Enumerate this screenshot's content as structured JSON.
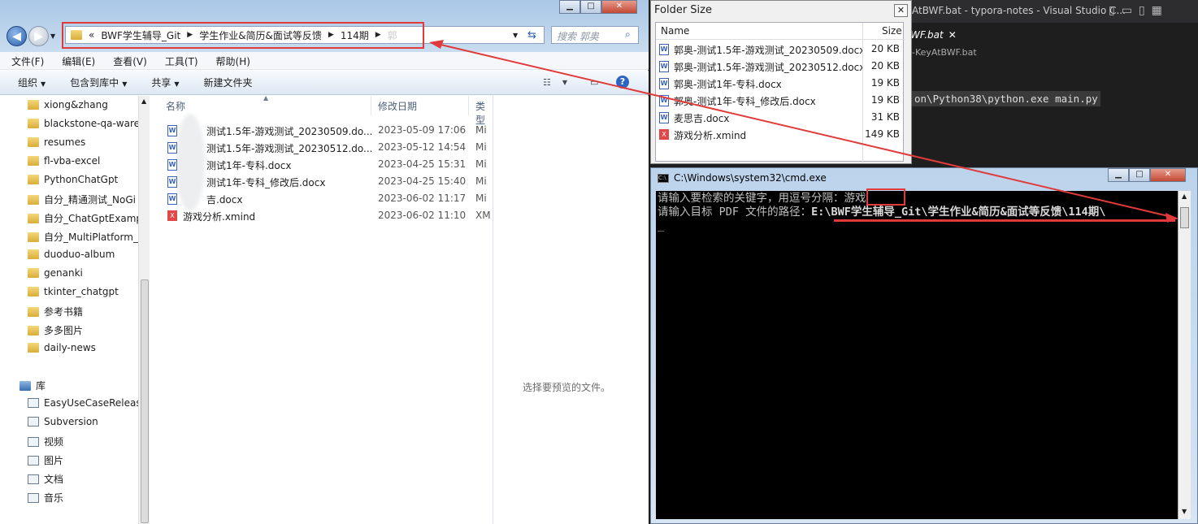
{
  "vscode": {
    "title": "AtBWF.bat - typora-notes - Visual Studio C...",
    "tab_label": "WF.bat",
    "breadcrumb": "-KeyAtBWF.bat",
    "code_line": "on\\Python38\\python.exe main.py"
  },
  "explorer": {
    "address": {
      "overflow": "«",
      "segments": [
        "BWF学生辅导_Git",
        "学生作业&简历&面试等反馈",
        "114期",
        "郭"
      ]
    },
    "search_placeholder": "搜索 郭奥",
    "menu": [
      "文件(F)",
      "编辑(E)",
      "查看(V)",
      "工具(T)",
      "帮助(H)"
    ],
    "toolbar": [
      "组织",
      "包含到库中",
      "共享",
      "新建文件夹"
    ],
    "nav_folders": [
      "xiong&zhang",
      "blackstone-qa-ware",
      "resumes",
      "fl-vba-excel",
      "PythonChatGpt",
      "自分_精通测试_NoGi",
      "自分_ChatGptExamp",
      "自分_MultiPlatform_",
      "duoduo-album",
      "genanki",
      "tkinter_chatgpt",
      "参考书籍",
      "多多图片",
      "daily-news"
    ],
    "library_label": "库",
    "libraries": [
      "EasyUseCaseRelease",
      "Subversion",
      "视频",
      "图片",
      "文档",
      "音乐"
    ],
    "columns": {
      "name": "名称",
      "date": "修改日期",
      "type": "类型"
    },
    "files": [
      {
        "name": "测试1.5年-游戏测试_20230509.do...",
        "date": "2023-05-09 17:06",
        "type": "Mi",
        "kind": "word"
      },
      {
        "name": "测试1.5年-游戏测试_20230512.do...",
        "date": "2023-05-12 14:54",
        "type": "Mi",
        "kind": "word"
      },
      {
        "name": "测试1年-专科.docx",
        "date": "2023-04-25 15:31",
        "type": "Mi",
        "kind": "word"
      },
      {
        "name": "测试1年-专科_修改后.docx",
        "date": "2023-04-25 15:40",
        "type": "Mi",
        "kind": "word"
      },
      {
        "name": "吉.docx",
        "date": "2023-06-02 11:17",
        "type": "Mi",
        "kind": "word"
      },
      {
        "name": "游戏分析.xmind",
        "date": "2023-06-02 11:10",
        "type": "XM",
        "kind": "xmind"
      }
    ],
    "preview_text": "选择要预览的文件。"
  },
  "folder_size": {
    "title": "Folder Size",
    "col_name": "Name",
    "col_size": "Size",
    "rows": [
      {
        "name": "郭奥-测试1.5年-游戏测试_20230509.docx",
        "size": "20 KB",
        "kind": "word"
      },
      {
        "name": "郭奥-测试1.5年-游戏测试_20230512.docx",
        "size": "20 KB",
        "kind": "word"
      },
      {
        "name": "郭奥-测试1年-专科.docx",
        "size": "19 KB",
        "kind": "word"
      },
      {
        "name": "郭奥-测试1年-专科_修改后.docx",
        "size": "19 KB",
        "kind": "word"
      },
      {
        "name": "麦思吉.docx",
        "size": "31 KB",
        "kind": "word"
      },
      {
        "name": "游戏分析.xmind",
        "size": "149 KB",
        "kind": "xmind"
      }
    ]
  },
  "cmd": {
    "title": "C:\\Windows\\system32\\cmd.exe",
    "line1_prompt": "请输入要检索的关键字，用逗号分隔：",
    "line1_value": "游戏",
    "line2_prompt": "请输入目标 PDF 文件的路径：",
    "line2_value": "E:\\BWF学生辅导_Git\\学生作业&简历&面试等反馈\\114期\\"
  },
  "colors": {
    "annotation": "#e03a3a",
    "console_bg": "#000000"
  }
}
